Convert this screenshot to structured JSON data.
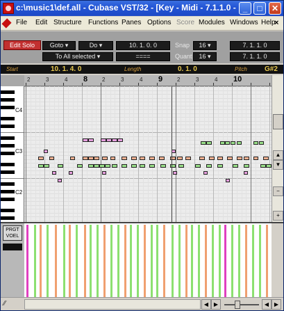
{
  "window": {
    "title": "c:\\music1\\def.all - Cubase VST/32 - [Key - Midi - 7.1.1.0 -",
    "min_symbol": "_",
    "max_symbol": "□",
    "close_symbol": "✕"
  },
  "menubar": {
    "items": [
      "File",
      "Edit",
      "Structure",
      "Functions",
      "Panes",
      "Options",
      "Score",
      "Modules",
      "Windows",
      "Help"
    ],
    "disabled": [
      "Score"
    ],
    "close_symbol": "×"
  },
  "toolbar": {
    "edit_solo": "Edit Solo",
    "goto": "Goto",
    "do": "Do",
    "position_top": "10. 1. 0.  0",
    "to_all_selected": "To All selected",
    "position_bottom": "====",
    "snap_label": "Snap",
    "snap_value": "16",
    "quant_label": "Quant",
    "quant_value": "16",
    "right_top": "7.  1.  1.  0",
    "right_bottom": "7.  1.  1.  0"
  },
  "infoline": {
    "start_label": "Start",
    "start_value": "10.  1.  4.      0",
    "length_label": "Length",
    "length_value": "0.   1.      0",
    "pitch_label": "Pitch",
    "pitch_value": "G#2"
  },
  "ruler": {
    "labels": [
      "2",
      "3",
      "4",
      "8",
      "2",
      "3",
      "4",
      "9",
      "2",
      "3",
      "4",
      "10"
    ],
    "major": [
      "8",
      "9",
      "10"
    ]
  },
  "keyboard": {
    "octaves": [
      "C4",
      "C3",
      "C2"
    ]
  },
  "controller": {
    "lane_label_line1": "PRGT",
    "lane_label_line2": "VOEL",
    "colors": {
      "green": "#8ce070",
      "orange": "#f0a070",
      "magenta": "#e040c0"
    }
  },
  "colors": {
    "note_green": "#9ae08a",
    "note_pink": "#e8a0e0",
    "note_orange": "#f0b090",
    "title_blue": "#2456d6",
    "edit_solo_red": "#c23030",
    "lcd_text": "#e8c850"
  }
}
